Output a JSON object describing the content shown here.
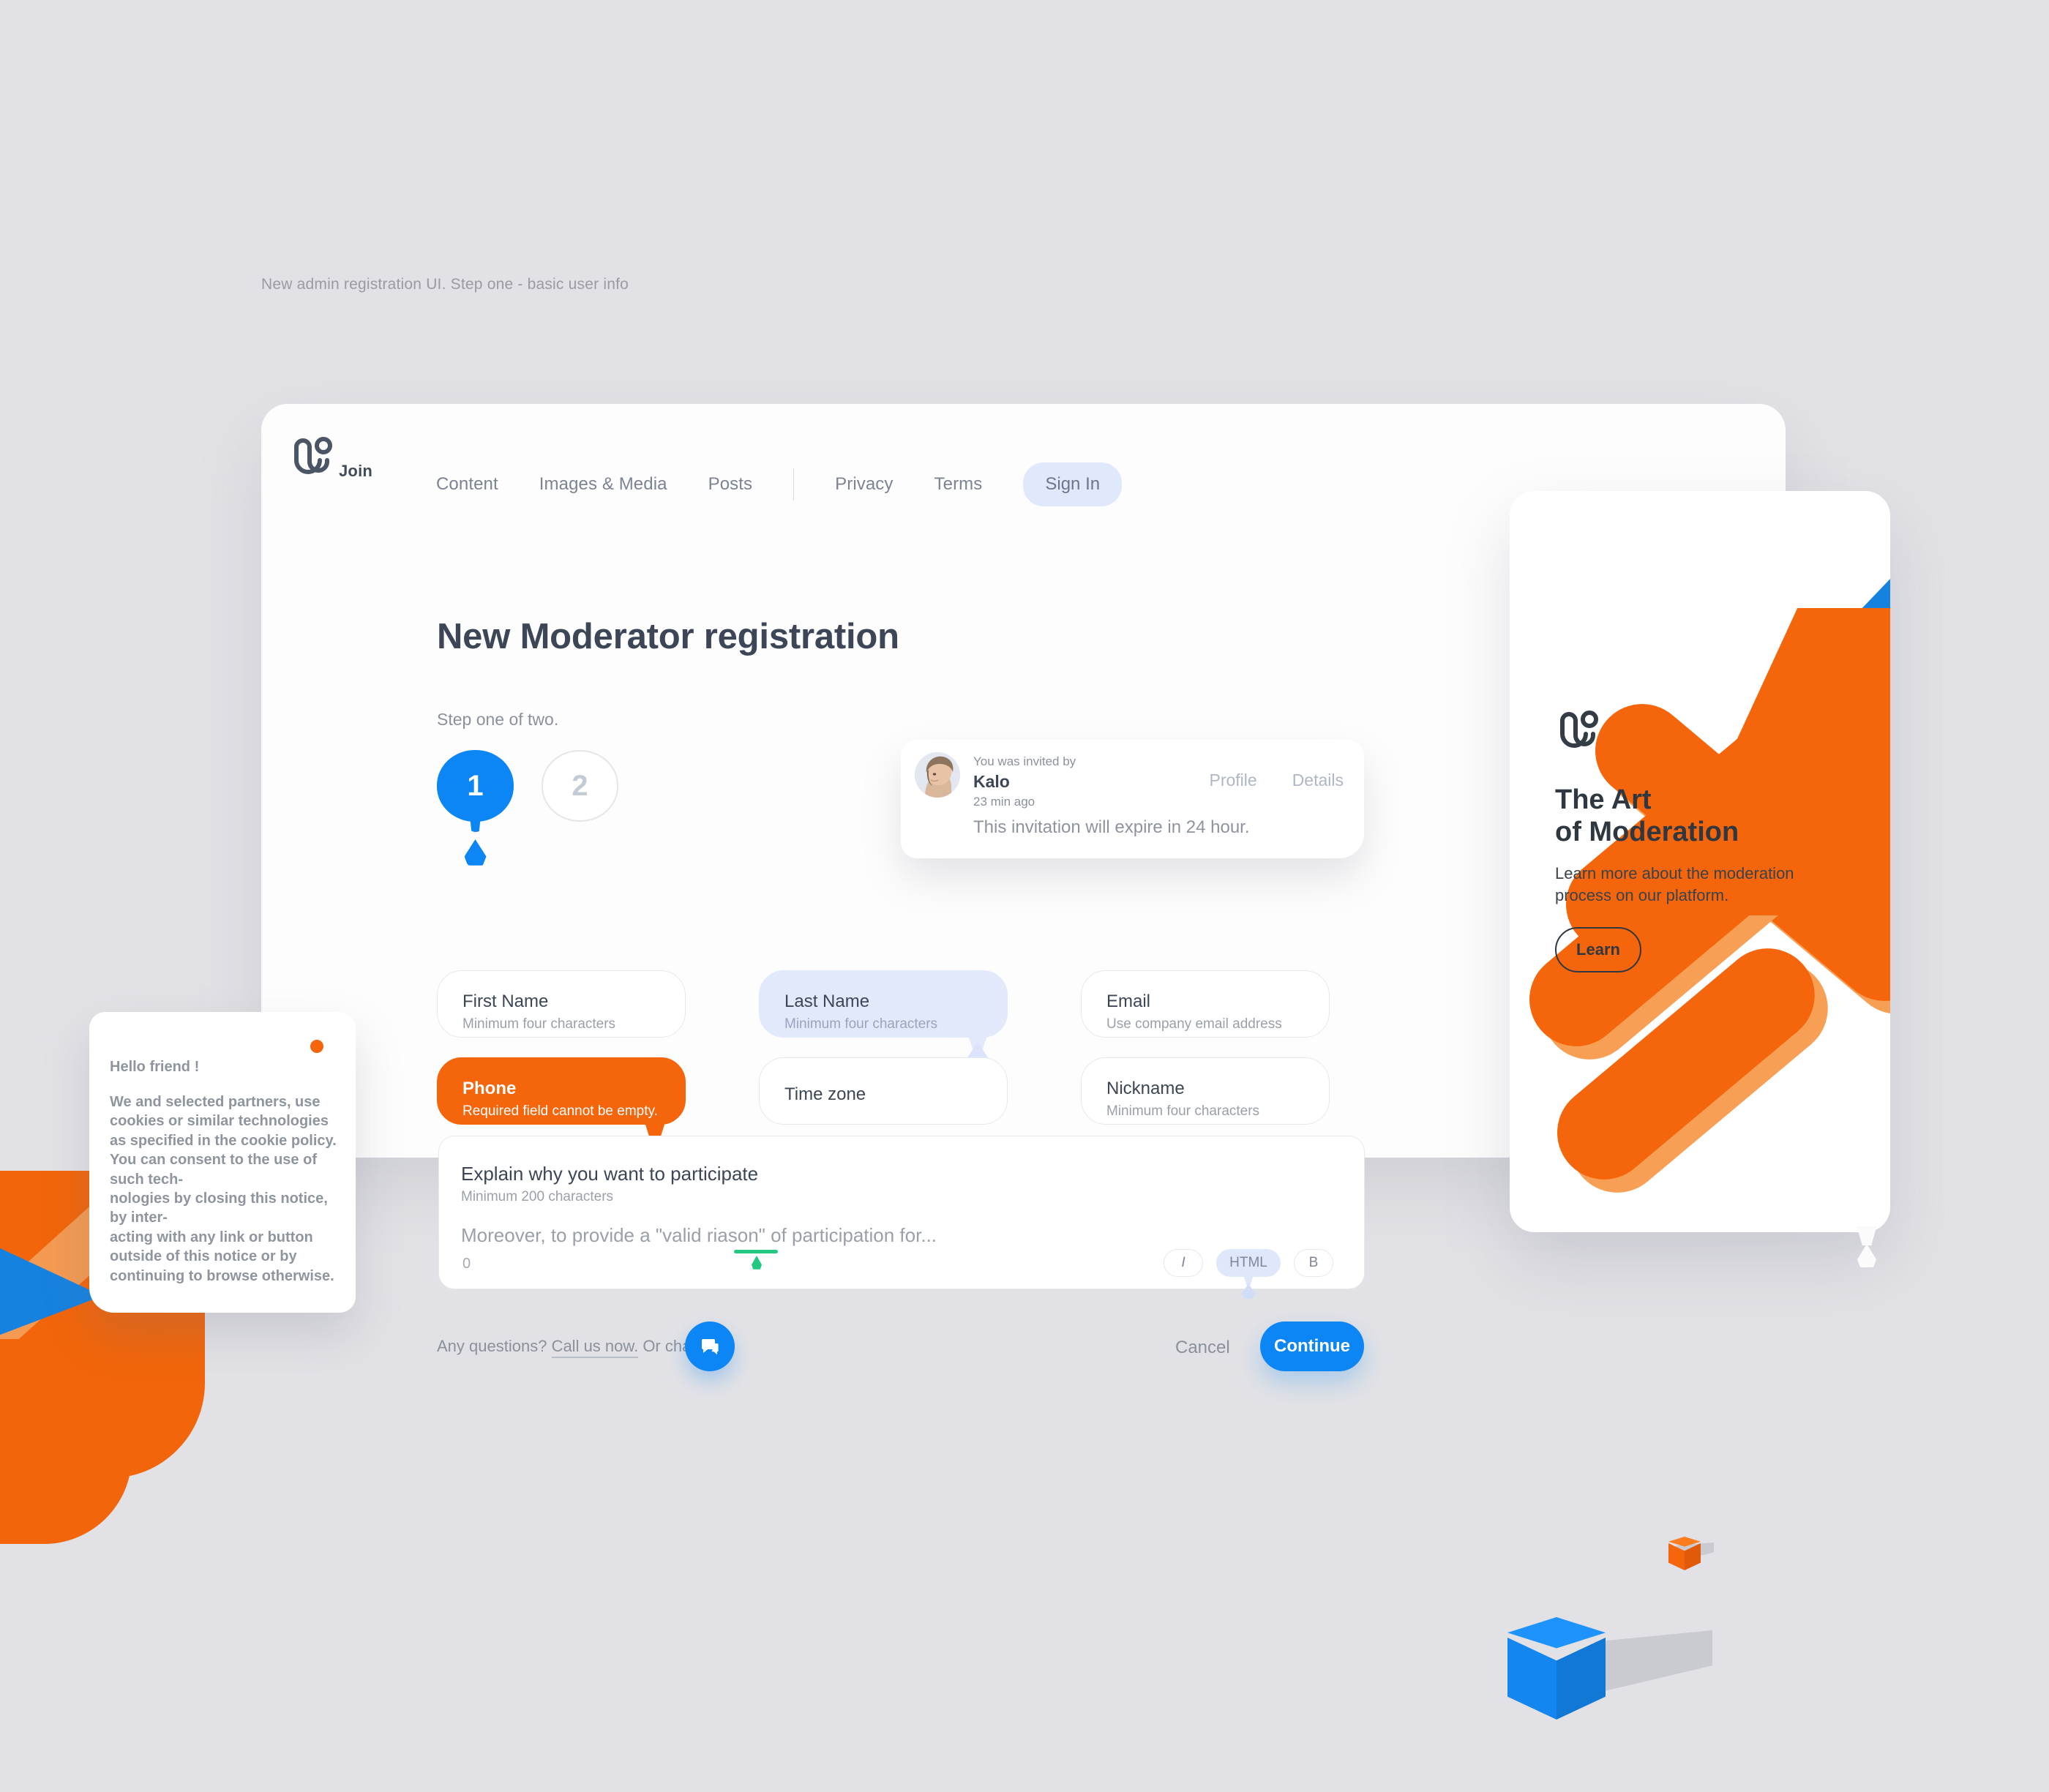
{
  "caption": "New admin registration UI. Step one - basic user info",
  "brand": {
    "logo_icon": "join-person-logo-icon",
    "name": "Join",
    "accent_blue": "#0d86f5",
    "accent_orange": "#f5650b",
    "accent_lavender": "#e2e9fb",
    "dark": "#3c4656"
  },
  "nav": {
    "links": [
      {
        "label": "Content"
      },
      {
        "label": "Images & Media"
      },
      {
        "label": "Posts"
      },
      {
        "label": "Privacy"
      },
      {
        "label": "Terms"
      }
    ],
    "signin_label": "Sign In"
  },
  "page": {
    "title": "New Moderator registration",
    "step_label": "Step one of two.",
    "steps": [
      {
        "number": "1",
        "state": "active"
      },
      {
        "number": "2",
        "state": "idle"
      }
    ]
  },
  "invitation": {
    "invited_by_label": "You was invited by",
    "name": "Kalo",
    "time": "23 min ago",
    "profile_label": "Profile",
    "details_label": "Details",
    "note": "This invitation will expire in 24 hour."
  },
  "form": {
    "fields": [
      {
        "label": "First Name",
        "hint": "Minimum four characters",
        "state": "default"
      },
      {
        "label": "Last Name",
        "hint": "Minimum four characters",
        "state": "filled"
      },
      {
        "label": "Email",
        "hint": "Use company email address",
        "state": "default"
      },
      {
        "label": "Phone",
        "hint": "Required field cannot be empty.",
        "state": "error"
      },
      {
        "label": "Time zone",
        "hint": "",
        "state": "default"
      },
      {
        "label": "Nickname",
        "hint": "Minimum four characters",
        "state": "default"
      }
    ],
    "textarea": {
      "label": "Explain why you want to participate",
      "hint": "Minimum 200 characters",
      "value": "Moreover, to provide a \"valid riason\" of participation for...",
      "misspelled_word": "riason",
      "char_count": "0",
      "format_buttons": [
        {
          "label": "I",
          "name": "italic",
          "active": false
        },
        {
          "label": "HTML",
          "name": "html",
          "active": true
        },
        {
          "label": "B",
          "name": "bold",
          "active": false
        }
      ]
    }
  },
  "footer": {
    "help_prefix": "Any questions?",
    "help_link": "Call us now.",
    "help_suffix": "Or chat",
    "chat_icon": "chat-bubble-icon",
    "cancel_label": "Cancel",
    "continue_label": "Continue"
  },
  "cookie": {
    "dot_color": "#f5650b",
    "greeting": "Hello friend !",
    "body": "We and selected partners, use cookies or similar technologies as specified in the cookie policy.\nYou can consent to the use of such tech-\nnologies by closing this notice, by inter-\nacting with any link or button outside of this notice or by continuing to browse otherwise."
  },
  "promo": {
    "logo_icon": "join-person-logo-icon",
    "title": "The Art\nof Moderation",
    "subtitle": "Learn more about the moderation\nprocess on our platform.",
    "button_label": "Learn"
  },
  "decor": {
    "cube_blue": "#1a8cf5",
    "cube_orange": "#f5650b",
    "shadow": "#c6c6cc"
  }
}
